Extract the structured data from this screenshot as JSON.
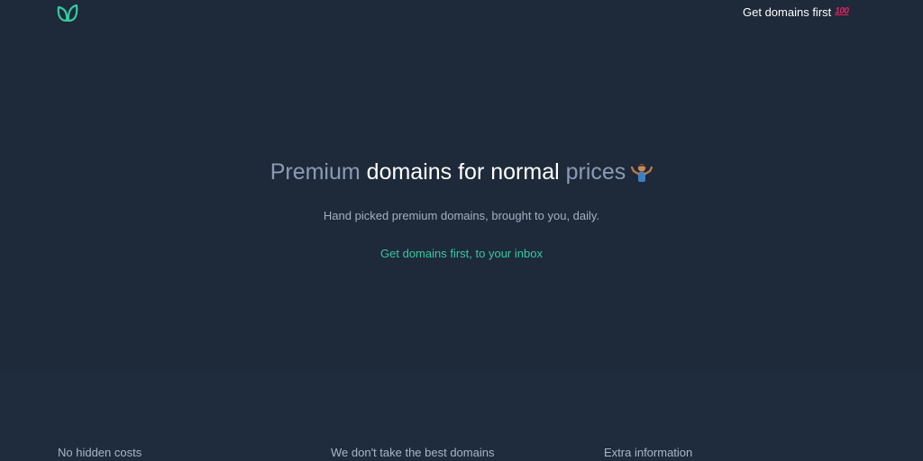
{
  "header": {
    "logo_icon": "leaf-sprout-icon",
    "cta_label": "Get domains first",
    "cta_icon": "hundred-points-emoji"
  },
  "hero": {
    "headline_parts": [
      "Premium ",
      "domains for normal",
      " prices"
    ],
    "headline_icon": "person-shrugging-emoji",
    "subtitle": "Hand picked premium domains, brought to you, daily.",
    "cta_link": "Get domains first, to your inbox"
  },
  "features": {
    "items": [
      "No hidden costs",
      "We don't take the best domains",
      "Extra information"
    ]
  },
  "colors": {
    "background": "#1e2939",
    "section_background": "#1f2c3e",
    "accent": "#38c8a0",
    "muted_text": "#8b9bb6"
  }
}
